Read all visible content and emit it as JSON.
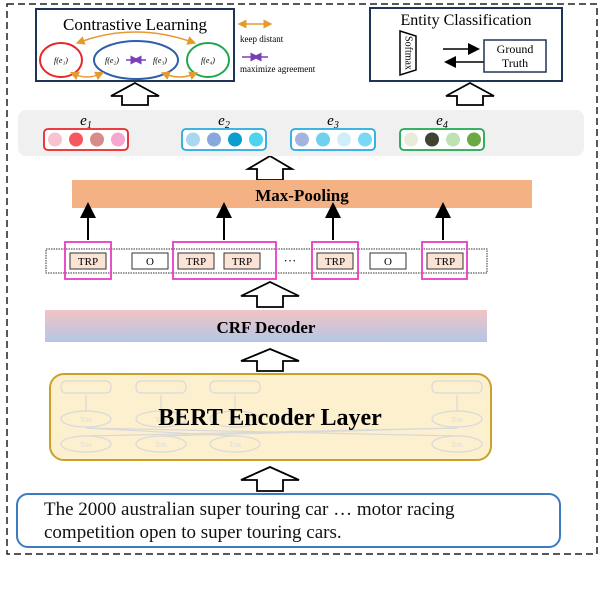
{
  "contrastive": {
    "title": "Contrastive Learning",
    "nodes": [
      "f(e₁)",
      "f(e₂)",
      "f(e₃)",
      "f(e₄)"
    ],
    "legend": [
      {
        "label": "keep distant",
        "color": "#e69a2e"
      },
      {
        "label": "maximize agreement",
        "color": "#7b3fb5"
      }
    ]
  },
  "classification": {
    "title": "Entity Classification",
    "softmax": "Softmax",
    "ground_truth_line1": "Ground",
    "ground_truth_line2": "Truth"
  },
  "entities": [
    {
      "label": "e",
      "sub": "1",
      "border": "#e8262a",
      "dots": [
        "#f6c3cf",
        "#f7575e",
        "#d88b8b",
        "#f6a6cf"
      ]
    },
    {
      "label": "e",
      "sub": "2",
      "border": "#25a9e0",
      "dots": [
        "#a8d8ef",
        "#86a8dd",
        "#0c9ccf",
        "#4ed3ec"
      ]
    },
    {
      "label": "e",
      "sub": "3",
      "border": "#25a9e0",
      "dots": [
        "#a4b4e0",
        "#6fd0f0",
        "#cfeefb",
        "#78d8f6"
      ]
    },
    {
      "label": "e",
      "sub": "4",
      "border": "#1fa84f",
      "dots": [
        "#e8ecd8",
        "#3f4330",
        "#bfe2b5",
        "#6aa943"
      ]
    }
  ],
  "max_pooling": "Max-Pooling",
  "tags": [
    "TRP",
    "O",
    "TRP",
    "TRP",
    "···",
    "TRP",
    "O",
    "TRP"
  ],
  "crf": "CRF Decoder",
  "bert": {
    "title": "BERT Encoder Layer",
    "trm": "Trm"
  },
  "sentence": {
    "line1": "The 2000 australian super touring car …  motor racing",
    "line2": "competition open to super touring cars."
  },
  "colors": {
    "max_pooling": "#f4b183",
    "tag_fill": "#fbe3d6",
    "span_box": "#e83cc4",
    "bert_fill": "#fdf0cf",
    "bert_border": "#c9a227"
  }
}
